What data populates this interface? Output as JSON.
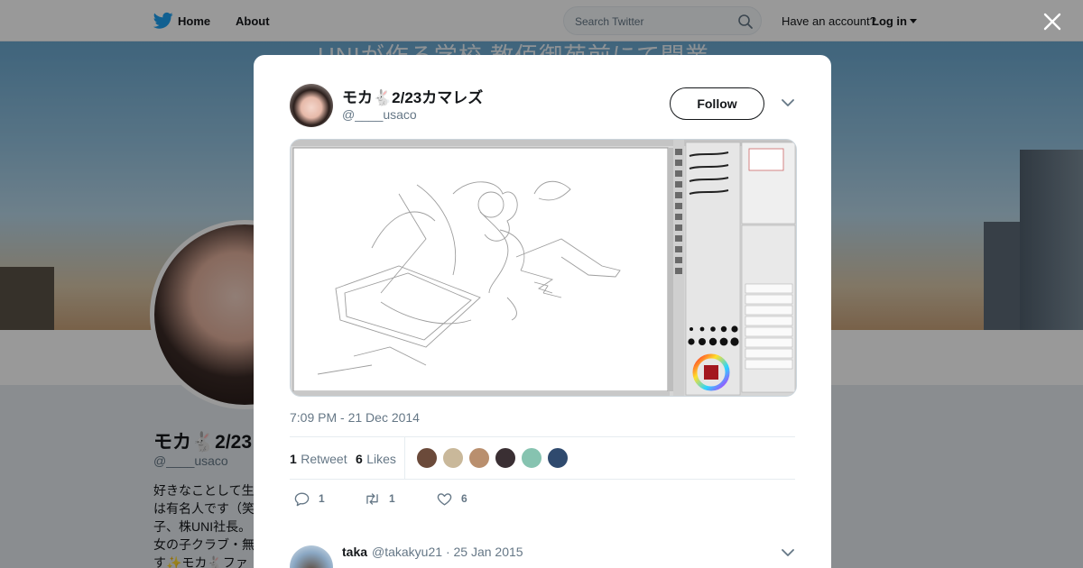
{
  "nav": {
    "home_label": "Home",
    "about_label": "About",
    "search_placeholder": "Search Twitter",
    "account_prompt": "Have an account?",
    "login_label": "Log in"
  },
  "banner": {
    "text": "UNIが作る学校 教佰御苑前にて開業"
  },
  "profile": {
    "name": "モカ🐇2/23",
    "handle": "@____usaco",
    "bio": "好きなことして生は有名人です（笑子、株UNI社長。女の子クラブ・無す✨モカ🐇ファ"
  },
  "tweet": {
    "author_name": "モカ🐇2/23カマレズ",
    "author_handle": "@____usaco",
    "follow_label": "Follow",
    "timestamp": "7:09 PM - 21 Dec 2014",
    "retweets_count": "1",
    "retweets_label": "Retweet",
    "likes_count": "6",
    "likes_label": "Likes",
    "reply_count": "1",
    "retweet_action_count": "1",
    "like_action_count": "6"
  },
  "likers": [
    {
      "color": "#6b4a3a"
    },
    {
      "color": "#c9b89a"
    },
    {
      "color": "#b98f6e"
    },
    {
      "color": "#3a2f33"
    },
    {
      "color": "#86c3b0"
    },
    {
      "color": "#2f4a6e"
    }
  ],
  "reply": {
    "name": "taka",
    "handle": "@takakyu21",
    "date": "25 Jan 2015",
    "separator": "·"
  },
  "colors": {
    "brand": "#1da1f2",
    "text": "#14171a",
    "muted": "#657786"
  }
}
